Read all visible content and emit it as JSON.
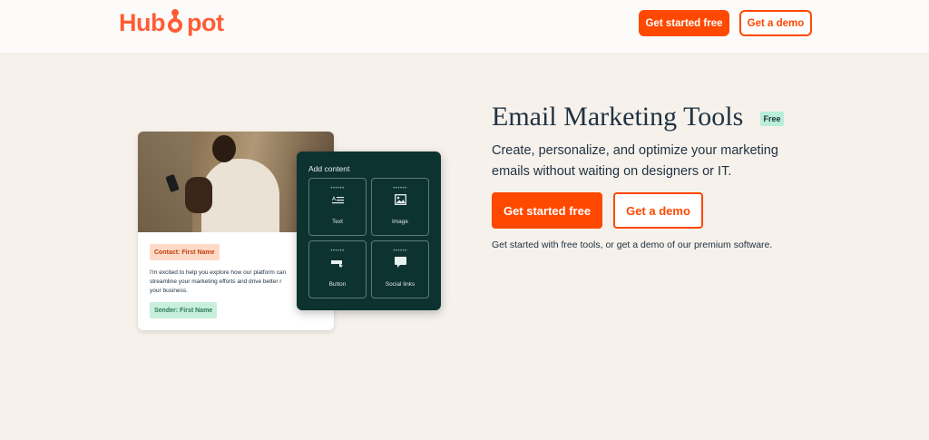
{
  "header": {
    "logo_text": "HubSpot",
    "logo_left": "Hub",
    "logo_right": "pot",
    "get_started_label": "Get started free",
    "demo_label": "Get a demo"
  },
  "hero": {
    "title": "Email Marketing Tools",
    "badge": "Free",
    "description": "Create, personalize, and optimize your marketing emails without waiting on designers or IT.",
    "get_started_label": "Get started free",
    "demo_label": "Get a demo",
    "note": "Get started with free tools, or get a demo of our premium software."
  },
  "email_preview": {
    "contact_tag": "Contact: First Name",
    "body_lines": [
      "I'm excited to help you explore how our platform can",
      "streamline your marketing efforts and drive better r",
      "your business."
    ],
    "sender_tag": "Sender: First Name"
  },
  "content_panel": {
    "title": "Add content",
    "tiles": [
      {
        "label": "Text",
        "icon": "text-icon"
      },
      {
        "label": "Image",
        "icon": "image-icon"
      },
      {
        "label": "Button",
        "icon": "button-icon"
      },
      {
        "label": "Social links",
        "icon": "social-links-icon"
      }
    ]
  },
  "colors": {
    "brand_orange": "#ff4800",
    "page_background": "#f6f1eb",
    "panel_background": "#0d3330",
    "badge_green": "#b9eed9"
  }
}
